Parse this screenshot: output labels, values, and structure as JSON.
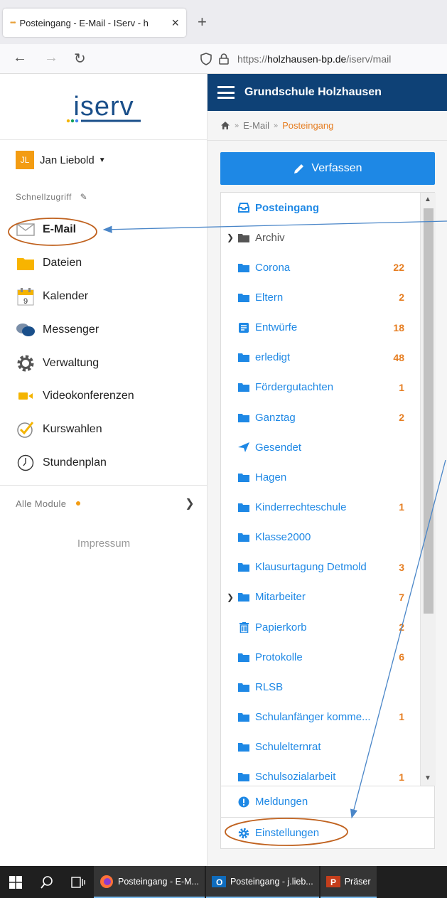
{
  "browser": {
    "tab_title": "Posteingang - E-Mail - IServ - h",
    "url_prefix": "https://",
    "url_domain": "holzhausen-bp.de",
    "url_path": "/iserv/mail"
  },
  "sidebar": {
    "logo_text": "iserv",
    "user_initials": "JL",
    "user_name": "Jan Liebold",
    "quick_access_label": "Schnellzugriff",
    "items": [
      {
        "label": "E-Mail",
        "icon": "envelope-icon"
      },
      {
        "label": "Dateien",
        "icon": "folder-icon"
      },
      {
        "label": "Kalender",
        "icon": "calendar-icon"
      },
      {
        "label": "Messenger",
        "icon": "chat-bubbles-icon"
      },
      {
        "label": "Verwaltung",
        "icon": "gear-icon"
      },
      {
        "label": "Videokonferenzen",
        "icon": "video-camera-icon"
      },
      {
        "label": "Kurswahlen",
        "icon": "checkmark-circle-icon"
      },
      {
        "label": "Stundenplan",
        "icon": "clock-icon"
      }
    ],
    "all_modules_label": "Alle Module",
    "impressum_label": "Impressum"
  },
  "header": {
    "school_name": "Grundschule Holzhausen"
  },
  "breadcrumb": {
    "level1": "E-Mail",
    "current": "Posteingang"
  },
  "compose_label": "Verfassen",
  "folders": [
    {
      "name": "Posteingang",
      "count": ""
    },
    {
      "name": "Archiv",
      "count": ""
    },
    {
      "name": "Corona",
      "count": "22"
    },
    {
      "name": "Eltern",
      "count": "2"
    },
    {
      "name": "Entwürfe",
      "count": "18"
    },
    {
      "name": "erledigt",
      "count": "48"
    },
    {
      "name": "Fördergutachten",
      "count": "1"
    },
    {
      "name": "Ganztag",
      "count": "2"
    },
    {
      "name": "Gesendet",
      "count": ""
    },
    {
      "name": "Hagen",
      "count": ""
    },
    {
      "name": "Kinderrechteschule",
      "count": "1"
    },
    {
      "name": "Klasse2000",
      "count": ""
    },
    {
      "name": "Klausurtagung Detmold",
      "count": "3"
    },
    {
      "name": "Mitarbeiter",
      "count": "7"
    },
    {
      "name": "Papierkorb",
      "count": "2"
    },
    {
      "name": "Protokolle",
      "count": "6"
    },
    {
      "name": "RLSB",
      "count": ""
    },
    {
      "name": "Schulanfänger komme...",
      "count": "1"
    },
    {
      "name": "Schulelternrat",
      "count": ""
    },
    {
      "name": "Schulsozialarbeit",
      "count": "1"
    }
  ],
  "panel_footer": {
    "notifications_label": "Meldungen",
    "settings_label": "Einstellungen"
  },
  "taskbar": {
    "app1": "Posteingang - E-M...",
    "app2": "Posteingang - j.lieb...",
    "app3": "Präser"
  },
  "colors": {
    "header_bg": "#0e4176",
    "accent_blue": "#1e88e5",
    "count_orange": "#e67e22",
    "annotation_circle": "#c0621f",
    "annotation_arrow": "#4a86c8"
  }
}
